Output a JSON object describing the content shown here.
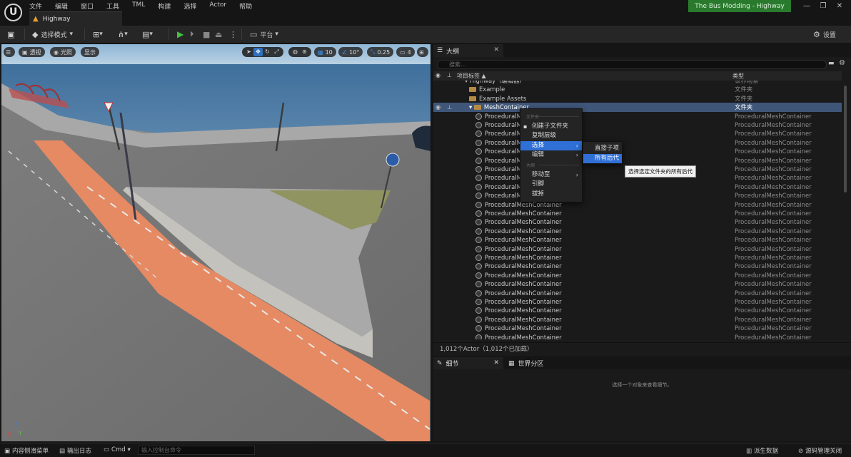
{
  "app": {
    "project_badge": "The Bus Modding - Highway",
    "menu": [
      "文件",
      "编辑",
      "窗口",
      "工具",
      "TML",
      "构建",
      "选择",
      "Actor",
      "帮助"
    ],
    "document_tab": "Highway",
    "window_controls": [
      "—",
      "❐",
      "✕"
    ]
  },
  "toolbar": {
    "save_icon": "save-icon",
    "select_mode": "选择模式",
    "platform": "平台",
    "settings": "设置"
  },
  "viewport": {
    "chips": {
      "perspective": "透视",
      "lit": "光照",
      "show": "显示"
    },
    "grid_snap": "10",
    "angle_snap": "10°",
    "scale_snap": "0.25",
    "camera_speed": "4",
    "axis": {
      "x": "X",
      "y": "Y",
      "z": "Z"
    }
  },
  "outliner": {
    "tab_label": "大纲",
    "search_placeholder": "搜索...",
    "col_label": "项目标签 ▲",
    "col_type": "类型",
    "rows": [
      {
        "name": "Highway（编辑器）",
        "type": "世界场景",
        "indent": 0,
        "kind": "world"
      },
      {
        "name": "Example",
        "type": "文件夹",
        "indent": 1,
        "kind": "folder"
      },
      {
        "name": "Example Assets",
        "type": "文件夹",
        "indent": 1,
        "kind": "folder"
      },
      {
        "name": "MeshContainer",
        "type": "文件夹",
        "indent": 1,
        "kind": "folder",
        "selected": true
      },
      {
        "name": "ProceduralMeshContainer",
        "type": "ProceduralMeshContainer",
        "indent": 2,
        "kind": "mesh"
      },
      {
        "name": "ProceduralMeshContainer",
        "type": "ProceduralMeshContainer",
        "indent": 2,
        "kind": "mesh"
      },
      {
        "name": "ProceduralMeshContainer",
        "type": "ProceduralMeshContainer",
        "indent": 2,
        "kind": "mesh"
      },
      {
        "name": "ProceduralMeshContainer",
        "type": "ProceduralMeshContainer",
        "indent": 2,
        "kind": "mesh"
      },
      {
        "name": "ProceduralMeshContainer",
        "type": "ProceduralMeshContainer",
        "indent": 2,
        "kind": "mesh"
      },
      {
        "name": "ProceduralMeshContainer",
        "type": "ProceduralMeshContainer",
        "indent": 2,
        "kind": "mesh"
      },
      {
        "name": "ProceduralMeshContainer",
        "type": "ProceduralMeshContainer",
        "indent": 2,
        "kind": "mesh"
      },
      {
        "name": "ProceduralMeshContainer",
        "type": "ProceduralMeshContainer",
        "indent": 2,
        "kind": "mesh"
      },
      {
        "name": "ProceduralMeshContainer",
        "type": "ProceduralMeshContainer",
        "indent": 2,
        "kind": "mesh"
      },
      {
        "name": "ProceduralMeshContainer",
        "type": "ProceduralMeshContainer",
        "indent": 2,
        "kind": "mesh"
      },
      {
        "name": "ProceduralMeshContainer",
        "type": "ProceduralMeshContainer",
        "indent": 2,
        "kind": "mesh"
      },
      {
        "name": "ProceduralMeshContainer",
        "type": "ProceduralMeshContainer",
        "indent": 2,
        "kind": "mesh"
      },
      {
        "name": "ProceduralMeshContainer",
        "type": "ProceduralMeshContainer",
        "indent": 2,
        "kind": "mesh"
      },
      {
        "name": "ProceduralMeshContainer",
        "type": "ProceduralMeshContainer",
        "indent": 2,
        "kind": "mesh"
      },
      {
        "name": "ProceduralMeshContainer",
        "type": "ProceduralMeshContainer",
        "indent": 2,
        "kind": "mesh"
      },
      {
        "name": "ProceduralMeshContainer",
        "type": "ProceduralMeshContainer",
        "indent": 2,
        "kind": "mesh"
      },
      {
        "name": "ProceduralMeshContainer",
        "type": "ProceduralMeshContainer",
        "indent": 2,
        "kind": "mesh"
      },
      {
        "name": "ProceduralMeshContainer",
        "type": "ProceduralMeshContainer",
        "indent": 2,
        "kind": "mesh"
      },
      {
        "name": "ProceduralMeshContainer",
        "type": "ProceduralMeshContainer",
        "indent": 2,
        "kind": "mesh"
      },
      {
        "name": "ProceduralMeshContainer",
        "type": "ProceduralMeshContainer",
        "indent": 2,
        "kind": "mesh"
      },
      {
        "name": "ProceduralMeshContainer",
        "type": "ProceduralMeshContainer",
        "indent": 2,
        "kind": "mesh"
      },
      {
        "name": "ProceduralMeshContainer",
        "type": "ProceduralMeshContainer",
        "indent": 2,
        "kind": "mesh"
      },
      {
        "name": "ProceduralMeshContainer",
        "type": "ProceduralMeshContainer",
        "indent": 2,
        "kind": "mesh"
      },
      {
        "name": "ProceduralMeshContainer",
        "type": "ProceduralMeshContainer",
        "indent": 2,
        "kind": "mesh"
      },
      {
        "name": "ProceduralMeshContainer",
        "type": "ProceduralMeshContainer",
        "indent": 2,
        "kind": "mesh"
      },
      {
        "name": "ProceduralMeshContainer",
        "type": "ProceduralMeshContainer",
        "indent": 2,
        "kind": "mesh"
      }
    ],
    "status": "1,012个Actor（1,012个已加载）"
  },
  "context_menu": {
    "section_folder": "文件夹",
    "section_outline": "大纲",
    "items": {
      "create_subfolder": "创建子文件夹",
      "duplicate_hierarchy": "复制层级",
      "select": "选择",
      "edit": "编辑",
      "move_to": "移动至",
      "pin": "引脚",
      "unpin": "拔掉"
    },
    "submenu": {
      "immediate_children": "直接子项",
      "all_descendants": "所有后代"
    },
    "tooltip": "选择选定文件夹的所有后代"
  },
  "details": {
    "tab_details": "细节",
    "tab_world_partition": "世界分区",
    "empty_text": "选择一个对象来查看细节。"
  },
  "statusbar": {
    "content_drawer": "内容侧滑菜单",
    "output_log": "输出日志",
    "cmd": "Cmd",
    "cmd_placeholder": "输入控制台命令",
    "derived_data": "派生数据",
    "source_control": "源码管理关闭"
  },
  "colors": {
    "accent_blue": "#2f6fd6",
    "selection_row": "#3f5678",
    "project_badge": "#2a7a2e",
    "play_green": "#44c140",
    "folder": "#b58a45"
  }
}
